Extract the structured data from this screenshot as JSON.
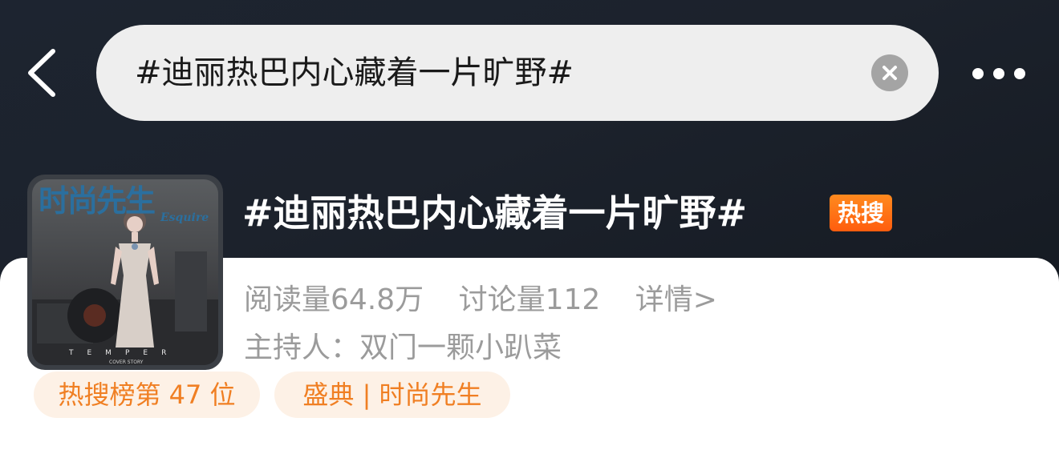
{
  "search": {
    "query": "#迪丽热巴内心藏着一片旷野#"
  },
  "cover": {
    "magazine_title": "时尚先生",
    "magazine_sub": "Esquire",
    "bottom_word": "TEMPER",
    "caption": "COVER STORY"
  },
  "topic": {
    "title": "#迪丽热巴内心藏着一片旷野#",
    "badge": "热搜",
    "reads": "阅读量64.8万",
    "discussions": "讨论量112",
    "detail": "详情>",
    "host": "主持人：双门一颗小趴菜"
  },
  "tags": {
    "rank": "热搜榜第 47 位",
    "event": "盛典 | 时尚先生"
  },
  "icons": {
    "back": "chevron-left-icon",
    "clear": "close-circle-icon",
    "more": "more-horizontal-icon"
  },
  "colors": {
    "header_bg": "#1c222c",
    "accent_orange": "#f07f23",
    "badge_orange": "#ff6a13",
    "tag_bg": "#fdf1e6",
    "meta_gray": "#9b9b9b"
  }
}
